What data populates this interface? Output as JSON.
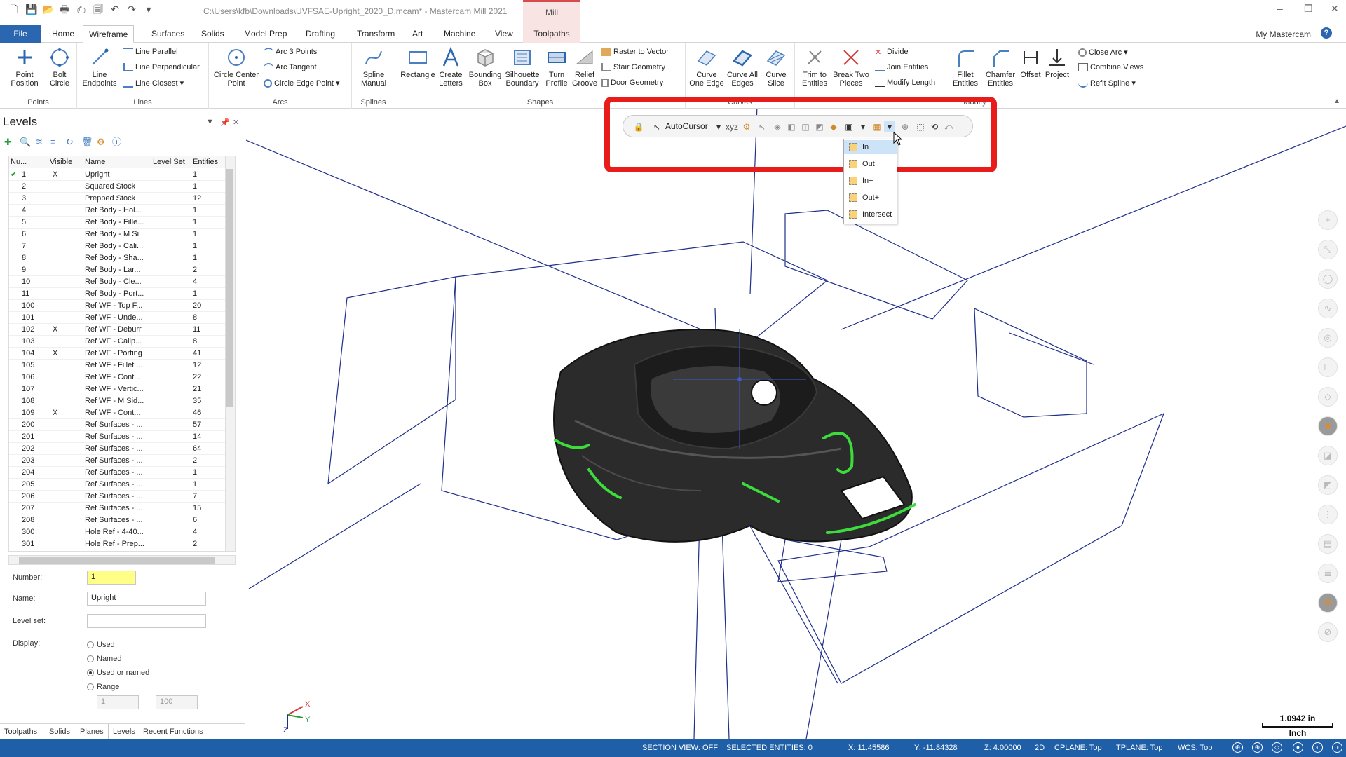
{
  "window": {
    "title": "C:\\Users\\kfb\\Downloads\\UVFSAE-Upright_2020_D.mcam* - Mastercam Mill 2021",
    "context_tab_label": "Mill"
  },
  "tabs": [
    "File",
    "Home",
    "Wireframe",
    "Surfaces",
    "Solids",
    "Model Prep",
    "Drafting",
    "Transform",
    "Art",
    "Machine",
    "View",
    "Toolpaths"
  ],
  "active_tab": "Wireframe",
  "account": "My Mastercam",
  "ribbon": {
    "points": {
      "label": "Points",
      "point_position": "Point Position",
      "bolt_circle": "Bolt Circle"
    },
    "lines": {
      "label": "Lines",
      "line_endpoints": "Line Endpoints",
      "line_parallel": "Line Parallel",
      "line_perpendicular": "Line Perpendicular",
      "line_closest": "Line Closest"
    },
    "arcs": {
      "label": "Arcs",
      "circle_center_point": "Circle Center Point",
      "arc_3_points": "Arc 3 Points",
      "arc_tangent": "Arc Tangent",
      "circle_edge_point": "Circle Edge Point"
    },
    "splines": {
      "label": "Splines",
      "spline_manual": "Spline Manual"
    },
    "shapes": {
      "label": "Shapes",
      "rectangle": "Rectangle",
      "create_letters": "Create Letters",
      "bounding_box": "Bounding Box",
      "silhouette_boundary": "Silhouette Boundary",
      "turn_profile": "Turn Profile",
      "relief_groove": "Relief Groove",
      "raster_to_vector": "Raster to Vector",
      "stair_geometry": "Stair Geometry",
      "door_geometry": "Door Geometry"
    },
    "curves": {
      "label": "Curves",
      "curve_one_edge": "Curve One Edge",
      "curve_all_edges": "Curve All Edges",
      "curve_slice": "Curve Slice"
    },
    "modify": {
      "label": "Modify",
      "trim_to_entities": "Trim to Entities",
      "break_two_pieces": "Break Two Pieces",
      "divide": "Divide",
      "join_entities": "Join Entities",
      "modify_length": "Modify Length",
      "fillet_entities": "Fillet Entities",
      "chamfer_entities": "Chamfer Entities",
      "offset": "Offset",
      "project": "Project",
      "close_arc": "Close Arc",
      "combine_views": "Combine Views",
      "refit_spline": "Refit Spline"
    }
  },
  "levels_panel": {
    "title": "Levels",
    "columns": [
      "Nu...",
      "Visible",
      "Name",
      "Level Set",
      "Entities"
    ],
    "rows": [
      {
        "num": "1",
        "visible": "X",
        "name": "Upright",
        "set": "",
        "entities": "1"
      },
      {
        "num": "2",
        "visible": "",
        "name": "Squared Stock",
        "set": "",
        "entities": "1"
      },
      {
        "num": "3",
        "visible": "",
        "name": "Prepped Stock",
        "set": "",
        "entities": "12"
      },
      {
        "num": "4",
        "visible": "",
        "name": "Ref Body - Hol...",
        "set": "",
        "entities": "1"
      },
      {
        "num": "5",
        "visible": "",
        "name": "Ref Body - Fille...",
        "set": "",
        "entities": "1"
      },
      {
        "num": "6",
        "visible": "",
        "name": "Ref Body - M Si...",
        "set": "",
        "entities": "1"
      },
      {
        "num": "7",
        "visible": "",
        "name": "Ref Body - Cali...",
        "set": "",
        "entities": "1"
      },
      {
        "num": "8",
        "visible": "",
        "name": "Ref Body - Sha...",
        "set": "",
        "entities": "1"
      },
      {
        "num": "9",
        "visible": "",
        "name": "Ref Body - Lar...",
        "set": "",
        "entities": "2"
      },
      {
        "num": "10",
        "visible": "",
        "name": "Ref Body - Cle...",
        "set": "",
        "entities": "4"
      },
      {
        "num": "11",
        "visible": "",
        "name": "Ref Body - Port...",
        "set": "",
        "entities": "1"
      },
      {
        "num": "100",
        "visible": "",
        "name": "Ref WF - Top F...",
        "set": "",
        "entities": "20"
      },
      {
        "num": "101",
        "visible": "",
        "name": "Ref WF - Unde...",
        "set": "",
        "entities": "8"
      },
      {
        "num": "102",
        "visible": "X",
        "name": "Ref WF - Deburr",
        "set": "",
        "entities": "11"
      },
      {
        "num": "103",
        "visible": "",
        "name": "Ref WF - Calip...",
        "set": "",
        "entities": "8"
      },
      {
        "num": "104",
        "visible": "X",
        "name": "Ref WF - Porting",
        "set": "",
        "entities": "41"
      },
      {
        "num": "105",
        "visible": "",
        "name": "Ref WF - Fillet ...",
        "set": "",
        "entities": "12"
      },
      {
        "num": "106",
        "visible": "",
        "name": "Ref WF - Cont...",
        "set": "",
        "entities": "22"
      },
      {
        "num": "107",
        "visible": "",
        "name": "Ref WF - Vertic...",
        "set": "",
        "entities": "21"
      },
      {
        "num": "108",
        "visible": "",
        "name": "Ref WF - M Sid...",
        "set": "",
        "entities": "35"
      },
      {
        "num": "109",
        "visible": "X",
        "name": "Ref WF - Cont...",
        "set": "",
        "entities": "46"
      },
      {
        "num": "200",
        "visible": "",
        "name": "Ref Surfaces - ...",
        "set": "",
        "entities": "57"
      },
      {
        "num": "201",
        "visible": "",
        "name": "Ref Surfaces - ...",
        "set": "",
        "entities": "14"
      },
      {
        "num": "202",
        "visible": "",
        "name": "Ref Surfaces - ...",
        "set": "",
        "entities": "64"
      },
      {
        "num": "203",
        "visible": "",
        "name": "Ref Surfaces - ...",
        "set": "",
        "entities": "2"
      },
      {
        "num": "204",
        "visible": "",
        "name": "Ref Surfaces - ...",
        "set": "",
        "entities": "1"
      },
      {
        "num": "205",
        "visible": "",
        "name": "Ref Surfaces - ...",
        "set": "",
        "entities": "1"
      },
      {
        "num": "206",
        "visible": "",
        "name": "Ref Surfaces - ...",
        "set": "",
        "entities": "7"
      },
      {
        "num": "207",
        "visible": "",
        "name": "Ref Surfaces - ...",
        "set": "",
        "entities": "15"
      },
      {
        "num": "208",
        "visible": "",
        "name": "Ref Surfaces - ...",
        "set": "",
        "entities": "6"
      },
      {
        "num": "300",
        "visible": "",
        "name": "Hole Ref - 4-40...",
        "set": "",
        "entities": "4"
      },
      {
        "num": "301",
        "visible": "",
        "name": "Hole Ref - Prep...",
        "set": "",
        "entities": "2"
      }
    ],
    "form": {
      "number_label": "Number:",
      "number_value": "1",
      "name_label": "Name:",
      "name_value": "Upright",
      "level_set_label": "Level set:",
      "level_set_value": "",
      "display_label": "Display:",
      "display_options": [
        "Used",
        "Named",
        "Used or named",
        "Range"
      ],
      "display_selected": "Used or named",
      "range_from": "1",
      "range_to": "100"
    }
  },
  "panel_tabs": [
    "Toolpaths",
    "Solids",
    "Planes",
    "Levels",
    "Recent Functions"
  ],
  "active_panel_tab": "Levels",
  "selection_toolbar": {
    "autocursor": "AutoCursor",
    "dropdown_items": [
      "In",
      "Out",
      "In+",
      "Out+",
      "Intersect"
    ],
    "highlighted_item": "In"
  },
  "scale": {
    "value": "1.0942 in",
    "unit": "Inch"
  },
  "triad": {
    "x": "X",
    "y": "Y",
    "z": "Z"
  },
  "statusbar": {
    "section_view": "SECTION VIEW: OFF",
    "selected_entities": "SELECTED ENTITIES: 0",
    "x": "X:  11.45586",
    "y": "Y:  -11.84328",
    "z": "Z:  4.00000",
    "mode": "2D",
    "cplane": "CPLANE: Top",
    "tplane": "TPLANE: Top",
    "wcs": "WCS: Top"
  },
  "colors": {
    "brand_blue": "#1e5fa8",
    "highlight_red": "#e91c1c",
    "chain_green": "#3ddc3d",
    "wire_blue": "#1f2f8a"
  }
}
